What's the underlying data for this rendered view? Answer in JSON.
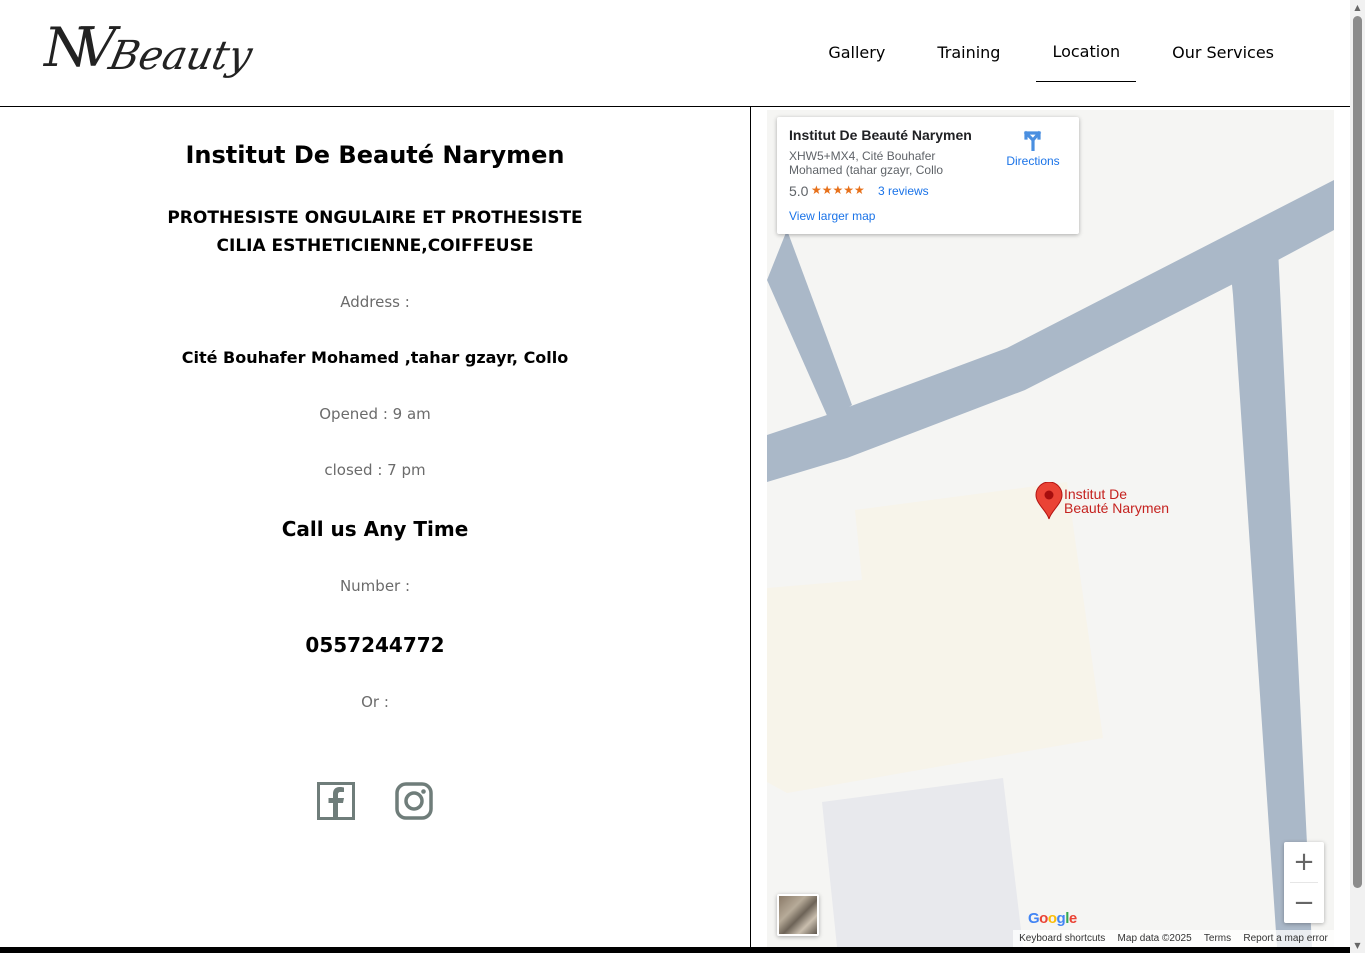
{
  "header": {
    "logo": {
      "monogram": "NV",
      "word": "Beauty"
    },
    "nav": [
      {
        "label": "Gallery",
        "active": false
      },
      {
        "label": "Training",
        "active": false
      },
      {
        "label": "Location",
        "active": true
      },
      {
        "label": "Our Services",
        "active": false
      }
    ]
  },
  "info": {
    "title": "Institut De Beauté Narymen",
    "subtitle": "PROTHESISTE ONGULAIRE ET PROTHESISTE CILIA ESTHETICIENNE,COIFFEUSE",
    "address_label": "Address :",
    "address_value": "Cité Bouhafer Mohamed ,tahar gzayr, Collo",
    "opened": "Opened : 9 am",
    "closed": "closed : 7 pm",
    "call_heading": "Call us Any Time",
    "number_label": "Number :",
    "number_value": "0557244772",
    "or_label": "Or :",
    "socials": [
      "facebook-icon",
      "instagram-icon"
    ],
    "social_color": "#6f7d7a"
  },
  "map": {
    "card": {
      "name": "Institut De Beauté Narymen",
      "address": "XHW5+MX4, Cité Bouhafer Mohamed (tahar gzayr, Collo",
      "rating": "5.0",
      "stars": "★★★★★",
      "reviews": "3 reviews",
      "larger_map": "View larger map",
      "directions": "Directions"
    },
    "pin_label_line1": "Institut De",
    "pin_label_line2": "Beauté Narymen",
    "zoom_in": "+",
    "zoom_out": "−",
    "google": "Google",
    "footer": [
      "Keyboard shortcuts",
      "Map data ©2025",
      "Terms",
      "Report a map error"
    ],
    "colors": {
      "road": "#aab8c8",
      "land": "#f5f5f3",
      "building": "#f7f4ea",
      "block": "#e8e9ed",
      "pin": "#ea4335"
    }
  }
}
